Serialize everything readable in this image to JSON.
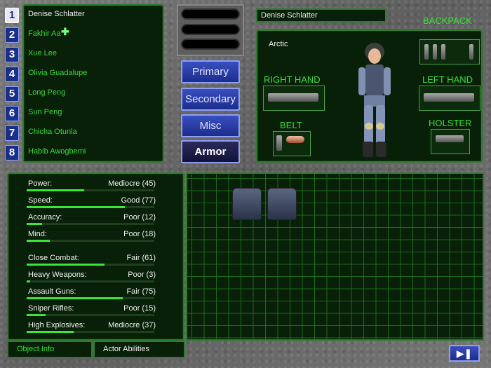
{
  "squad": {
    "members": [
      {
        "num": "1",
        "name": "Denise Schlatter",
        "active": true
      },
      {
        "num": "2",
        "name": "Fakhir Aa"
      },
      {
        "num": "3",
        "name": "Xue Lee"
      },
      {
        "num": "4",
        "name": "Olivia Guadalupe"
      },
      {
        "num": "5",
        "name": "Long Peng"
      },
      {
        "num": "6",
        "name": "Sun Peng"
      },
      {
        "num": "7",
        "name": "Chicha Otunla"
      },
      {
        "num": "8",
        "name": "Habib Awogbemi"
      }
    ]
  },
  "tabs": {
    "primary": "Primary",
    "secondary": "Secondary",
    "misc": "Misc",
    "armor": "Armor"
  },
  "equip": {
    "character_name": "Denise Schlatter",
    "camo": "Arctic",
    "backpack": "BACKPACK",
    "right_hand": "RIGHT HAND",
    "left_hand": "LEFT HAND",
    "belt": "BELT",
    "holster": "HOLSTER"
  },
  "stats": [
    {
      "label": "Power:",
      "value": "Mediocre (45)",
      "level": 45
    },
    {
      "label": "Speed:",
      "value": "Good (77)",
      "level": 77
    },
    {
      "label": "Accuracy:",
      "value": "Poor (12)",
      "level": 12
    },
    {
      "label": "Mind:",
      "value": "Poor (18)",
      "level": 18
    },
    {
      "label": "Close Combat:",
      "value": "Fair (61)",
      "level": 61
    },
    {
      "label": "Heavy Weapons:",
      "value": "Poor (3)",
      "level": 3
    },
    {
      "label": "Assault Guns:",
      "value": "Fair (75)",
      "level": 75
    },
    {
      "label": "Sniper Rifles:",
      "value": "Poor (15)",
      "level": 15
    },
    {
      "label": "High Explosives:",
      "value": "Mediocre (37)",
      "level": 37
    }
  ],
  "bottom": {
    "object_info": "Object Info",
    "actor_abilities": "Actor Abilities"
  },
  "icons": {
    "next": "next-turn-icon",
    "crosshair": "crosshair-icon"
  },
  "colors": {
    "accent": "#39e039",
    "button": "#1c2d8c"
  }
}
